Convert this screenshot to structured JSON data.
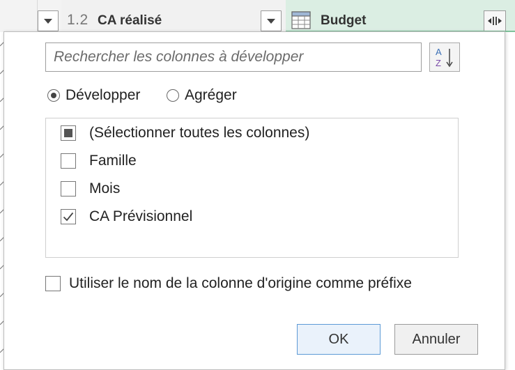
{
  "header": {
    "ca_type": "1.2",
    "ca_label": "CA réalisé",
    "budget_label": "Budget"
  },
  "dialog": {
    "search": {
      "placeholder": "Rechercher les colonnes à développer",
      "value": ""
    },
    "sort_icon": "sort-az-icon",
    "mode": {
      "selected": "expand",
      "expand_label": "Développer",
      "aggregate_label": "Agréger"
    },
    "columns": [
      {
        "label": "(Sélectionner toutes les colonnes)",
        "state": "partial"
      },
      {
        "label": "Famille",
        "state": "unchecked"
      },
      {
        "label": "Mois",
        "state": "unchecked"
      },
      {
        "label": "CA Prévisionnel",
        "state": "checked"
      }
    ],
    "prefix": {
      "label": "Utiliser le nom de la colonne d'origine comme préfixe",
      "checked": false
    },
    "ok_label": "OK",
    "cancel_label": "Annuler"
  },
  "colors": {
    "budget_header_bg": "#dbeee3",
    "budget_underline": "#7fc29b",
    "ok_border": "#5d9ad6"
  }
}
